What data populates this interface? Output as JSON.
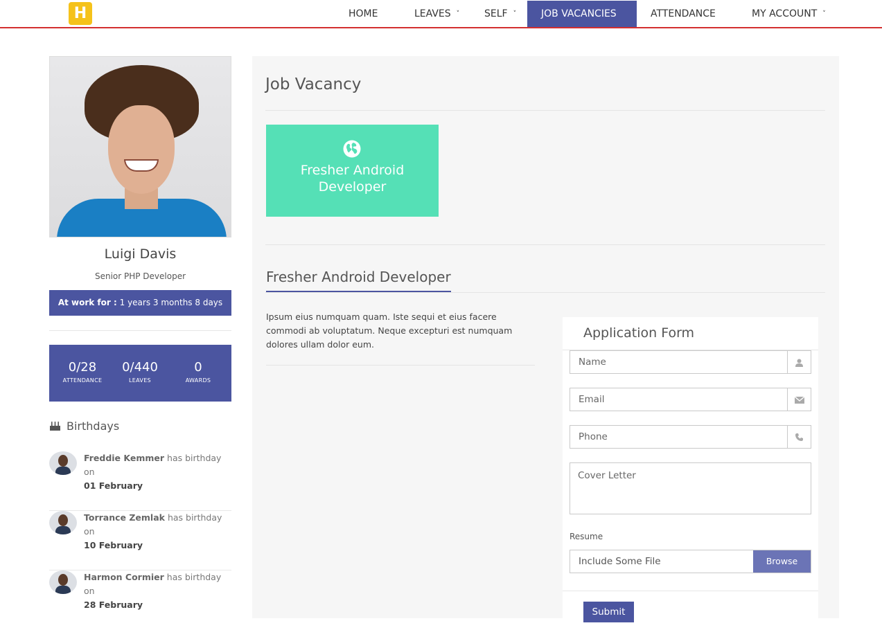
{
  "brand": {
    "logo_letter": "H",
    "logo_color": "#f5c21b"
  },
  "nav": {
    "items": [
      {
        "label": "HOME",
        "has_caret": false,
        "active": false
      },
      {
        "label": "LEAVES",
        "has_caret": true,
        "active": false
      },
      {
        "label": "SELF",
        "has_caret": true,
        "active": false
      },
      {
        "label": "JOB VACANCIES",
        "has_caret": false,
        "active": true
      },
      {
        "label": "ATTENDANCE",
        "has_caret": false,
        "active": false
      },
      {
        "label": "MY ACCOUNT",
        "has_caret": true,
        "active": false
      }
    ],
    "caret_glyph": "˅",
    "accent_color": "#4b55a0",
    "underline_color": "#d32f2f"
  },
  "profile": {
    "name": "Luigi Davis",
    "role": "Senior PHP Developer",
    "at_work_label": "At work for :",
    "at_work_value": "1 years 3 months 8 days",
    "stats": [
      {
        "value": "0/28",
        "label": "ATTENDANCE"
      },
      {
        "value": "0/440",
        "label": "LEAVES"
      },
      {
        "value": "0",
        "label": "AWARDS"
      }
    ]
  },
  "birthdays": {
    "heading": "Birthdays",
    "items": [
      {
        "name": "Freddie Kemmer",
        "text": "has birthday on",
        "date": "01 February"
      },
      {
        "name": "Torrance Zemlak",
        "text": "has birthday on",
        "date": "10 February"
      },
      {
        "name": "Harmon Cormier",
        "text": "has birthday on",
        "date": "28 February"
      }
    ]
  },
  "main": {
    "page_title": "Job Vacancy",
    "job_card": {
      "title": "Fresher Android Developer",
      "icon": "globe-icon",
      "color": "#55e0b6"
    },
    "section_title": "Fresher Android Developer",
    "description": "Ipsum eius numquam quam. Iste sequi et eius facere commodi ab voluptatum. Neque excepturi est numquam dolores ullam dolor eum."
  },
  "form": {
    "title": "Application Form",
    "name_placeholder": "Name",
    "email_placeholder": "Email",
    "phone_placeholder": "Phone",
    "cover_placeholder": "Cover Letter",
    "resume_label": "Resume",
    "file_placeholder": "Include Some File",
    "browse_label": "Browse",
    "submit_label": "Submit",
    "icons": {
      "name": "user-icon",
      "email": "envelope-icon",
      "phone": "phone-icon"
    }
  }
}
